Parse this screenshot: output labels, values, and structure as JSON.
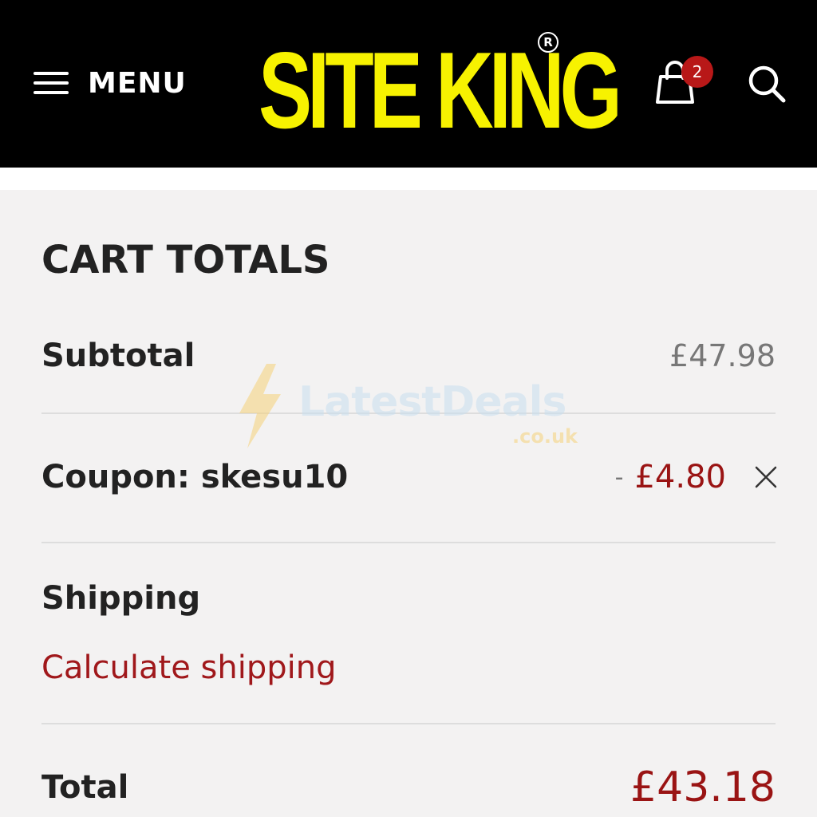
{
  "header": {
    "menu_label": "MENU",
    "logo_text": "SITE KING",
    "logo_registered": "R",
    "cart_count": "2",
    "brand_color": "#f7f200",
    "icons": [
      "hamburger-icon",
      "shopping-bag-icon",
      "search-icon"
    ]
  },
  "cart_totals": {
    "title": "CART TOTALS",
    "subtotal_label": "Subtotal",
    "subtotal_value": "£47.98",
    "coupon_label": "Coupon: skesu10",
    "coupon_dash": "-",
    "coupon_value": "£4.80",
    "shipping_label": "Shipping",
    "calculate_shipping_label": "Calculate shipping",
    "total_label": "Total",
    "total_value": "£43.18",
    "accent_color": "#9a1414"
  },
  "watermark": {
    "text": "LatestDeals",
    "sub": ".co.uk"
  }
}
